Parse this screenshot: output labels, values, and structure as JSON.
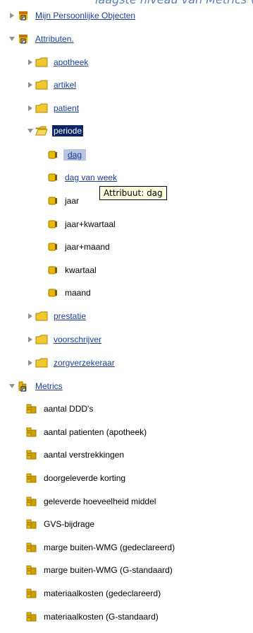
{
  "caption": "laagste niveau van Metrics vo",
  "tree": {
    "personal_objects": "Mijn Persoonlijke Objecten",
    "attributes": "Attributen.",
    "apotheek": "apotheek",
    "artikel": "artikel",
    "patient": "patient",
    "periode": "periode",
    "dag": "dag",
    "dag_van_week": "dag van week",
    "jaar": "jaar",
    "jaar_kwartaal": "jaar+kwartaal",
    "jaar_maand": "jaar+maand",
    "kwartaal": "kwartaal",
    "maand": "maand",
    "prestatie": "prestatie",
    "voorschrijver": "voorschrijver",
    "zorgverzekeraar": "zorgverzekeraar",
    "metrics": "Metrics",
    "metric_items": [
      "aantal DDD's",
      "aantal patienten (apotheek)",
      "aantal verstrekkingen",
      "doorgeleverde korting",
      "geleverde hoeveelheid middel",
      "GVS-bijdrage",
      "marge buiten-WMG (gedeclareerd)",
      "marge buiten-WMG (G-standaard)",
      "materiaalkosten (gedeclareerd)",
      "materiaalkosten (G-standaard)"
    ]
  },
  "tooltip": "Attribuut:  dag",
  "colors": {
    "link": "#1a3da0",
    "selected_bg": "#0a246a",
    "highlight_bg": "#b8c4e0",
    "folder": "#f0c832",
    "attribute_icon": "#e8b800",
    "metric_icon": "#c8a000",
    "tooltip_bg": "#ffffe1"
  }
}
